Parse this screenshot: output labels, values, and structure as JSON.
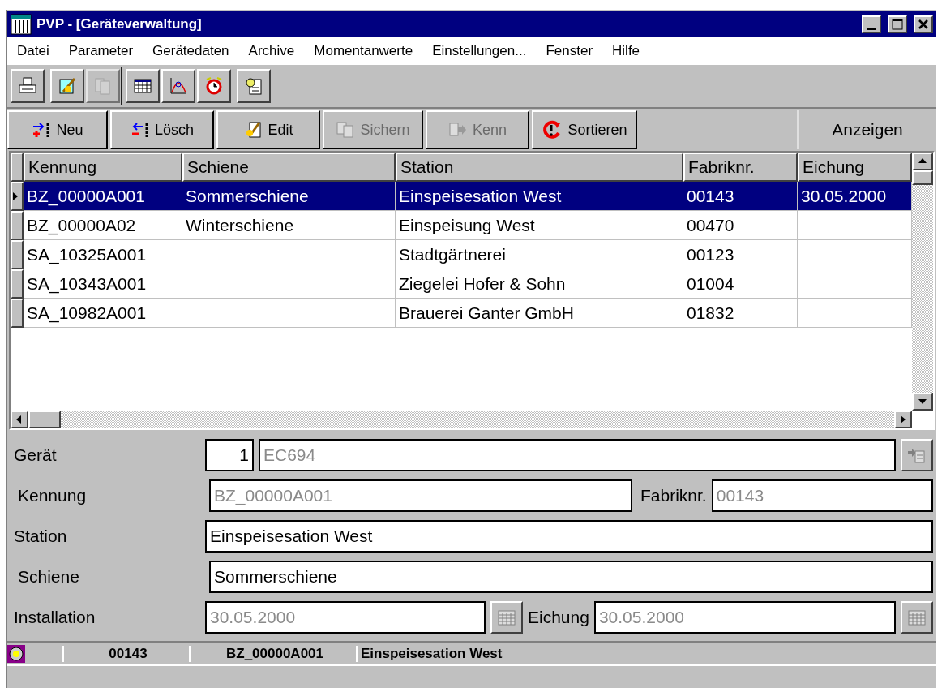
{
  "window": {
    "title": "PVP - [Geräteverwaltung]"
  },
  "menu": [
    "Datei",
    "Parameter",
    "Gerätedaten",
    "Archive",
    "Momentanwerte",
    "Einstellungen...",
    "Fenster",
    "Hilfe"
  ],
  "toolbar": [
    {
      "kind": "printer",
      "disabled": false
    },
    {
      "kind": "notepad",
      "disabled": false
    },
    {
      "kind": "pages",
      "disabled": true
    },
    {
      "kind": "table",
      "disabled": false
    },
    {
      "kind": "chart",
      "disabled": false
    },
    {
      "kind": "clock",
      "disabled": false
    },
    {
      "kind": "document",
      "disabled": false
    }
  ],
  "actions": [
    {
      "label": "Neu",
      "kind": "add",
      "disabled": false
    },
    {
      "label": "Lösch",
      "kind": "delete",
      "disabled": false
    },
    {
      "label": "Edit",
      "kind": "edit",
      "disabled": false
    },
    {
      "label": "Sichern",
      "kind": "save",
      "disabled": true
    },
    {
      "label": "Kenn",
      "kind": "arrow",
      "disabled": true
    },
    {
      "label": "Sortieren",
      "kind": "sort",
      "disabled": false
    }
  ],
  "view_label": "Anzeigen",
  "table": {
    "columns": [
      "Kennung",
      "Schiene",
      "Station",
      "Fabriknr.",
      "Eichung"
    ],
    "rows": [
      {
        "selected": true,
        "cells": [
          "BZ_00000A001",
          "Sommerschiene",
          "Einspeisesation West",
          "00143",
          "30.05.2000"
        ]
      },
      {
        "selected": false,
        "cells": [
          "BZ_00000A02",
          "Winterschiene",
          "Einspeisung West",
          "00470",
          ""
        ]
      },
      {
        "selected": false,
        "cells": [
          "SA_10325A001",
          "",
          "Stadtgärtnerei",
          "00123",
          ""
        ]
      },
      {
        "selected": false,
        "cells": [
          "SA_10343A001",
          "",
          "Ziegelei Hofer & Sohn",
          "01004",
          ""
        ]
      },
      {
        "selected": false,
        "cells": [
          "SA_10982A001",
          "",
          "Brauerei Ganter GmbH",
          "01832",
          ""
        ]
      }
    ]
  },
  "form": {
    "geraet": {
      "label": "Gerät",
      "number": "1",
      "value": "EC694",
      "disabled": true
    },
    "kennung": {
      "label": "Kennung",
      "value": "BZ_00000A001",
      "disabled": true
    },
    "fabriknr": {
      "label": "Fabriknr.",
      "value": "00143",
      "disabled": true
    },
    "station": {
      "label": "Station",
      "value": "Einspeisesation West",
      "disabled": false
    },
    "schiene": {
      "label": "Schiene",
      "value": "Sommerschiene",
      "disabled": false
    },
    "installation": {
      "label": "Installation",
      "value": "30.05.2000",
      "disabled": true
    },
    "eichung": {
      "label": "Eichung",
      "value": "30.05.2000",
      "disabled": true
    }
  },
  "status_bar": [
    "00143",
    "BZ_00000A001",
    "Einspeisesation West"
  ]
}
